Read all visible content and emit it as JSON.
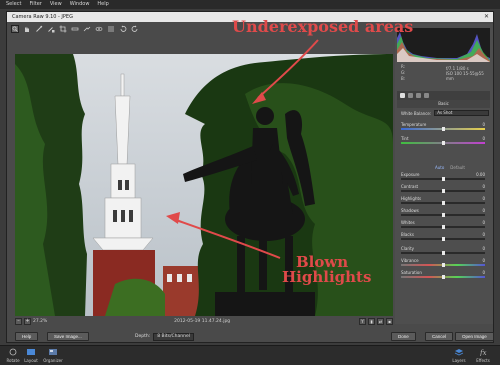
{
  "menubar": {
    "items": [
      "Select",
      "Filter",
      "View",
      "Window",
      "Help"
    ]
  },
  "dialog": {
    "title": "Camera Raw 9.10  -  JPEG",
    "close": "✕"
  },
  "image": {
    "filename": "2012-05-19 11.47.24.jpg",
    "zoom": "27.2%"
  },
  "annotations": {
    "underexposed": "Underexposed areas",
    "blown_line1": "Blown",
    "blown_line2": "Highlights"
  },
  "histogram_readout": {
    "r": "R:",
    "g": "G:",
    "b": "B:",
    "meta_line1": "f/7.1  1/80 s",
    "meta_line2": "ISO 100   15-55@55 mm"
  },
  "panel": {
    "section_title": "Basic",
    "white_balance_label": "White Balance:",
    "white_balance_value": "As Shot",
    "auto_label": "Auto",
    "default_label": "Default",
    "sliders": [
      {
        "label": "Temperature",
        "value": "0",
        "level": 0.5
      },
      {
        "label": "Tint",
        "value": "0",
        "level": 0.5
      },
      {
        "label": "Exposure",
        "value": "0.00",
        "level": 0.5
      },
      {
        "label": "Contrast",
        "value": "0",
        "level": 0.5
      },
      {
        "label": "Highlights",
        "value": "0",
        "level": 0.5
      },
      {
        "label": "Shadows",
        "value": "0",
        "level": 0.5
      },
      {
        "label": "Whites",
        "value": "0",
        "level": 0.5
      },
      {
        "label": "Blacks",
        "value": "0",
        "level": 0.5
      },
      {
        "label": "Clarity",
        "value": "0",
        "level": 0.5
      },
      {
        "label": "Vibrance",
        "value": "0",
        "level": 0.5
      },
      {
        "label": "Saturation",
        "value": "0",
        "level": 0.5
      }
    ]
  },
  "footer": {
    "help": "Help",
    "save": "Save Image...",
    "depth_label": "Depth:",
    "depth_value": "8 Bits/Channel",
    "done": "Done",
    "cancel": "Cancel",
    "open": "Open Image"
  },
  "taskbar": {
    "left": [
      {
        "label": "Rotate"
      },
      {
        "label": "Layout"
      },
      {
        "label": "Organizer"
      }
    ],
    "right": [
      {
        "label": "Layers"
      },
      {
        "label": "Effects"
      }
    ]
  },
  "colors": {
    "annotation": "#e04a4a",
    "accent": "#9bbcff"
  }
}
